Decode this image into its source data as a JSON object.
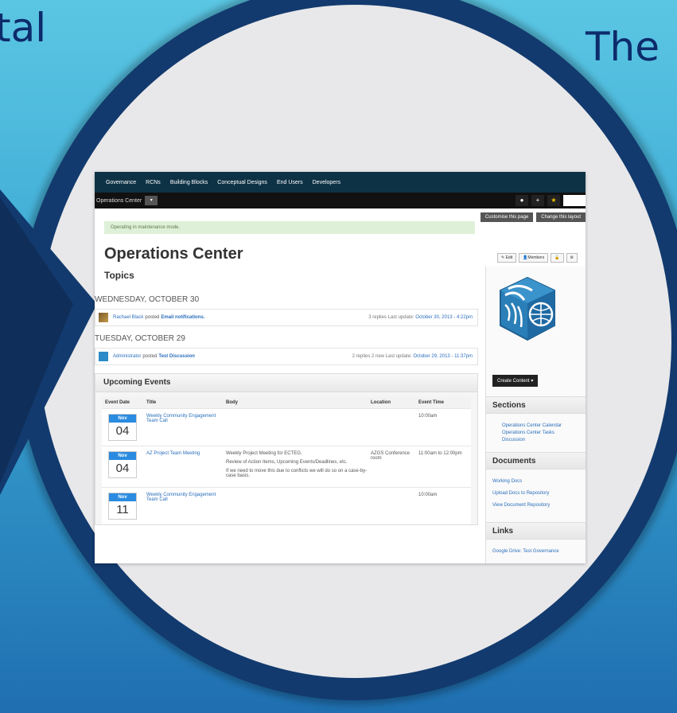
{
  "slide": {
    "word_left": "tal",
    "word_right": "The"
  },
  "nav": {
    "items": [
      "Governance",
      "RCNs",
      "Building Blocks",
      "Conceptual Designs",
      "End Users",
      "Developers"
    ]
  },
  "breadcrumb": {
    "label": "Operations Center",
    "toggle": "▾"
  },
  "toolbar": {
    "customise": "Customise this page",
    "change_layout": "Change this layout"
  },
  "alert": {
    "text": "Operating in maintenance mode."
  },
  "page": {
    "title": "Operations Center",
    "topics_heading": "Topics"
  },
  "topics": [
    {
      "day": "WEDNESDAY, OCTOBER 30",
      "author": "Rachael Black",
      "verb": "posted",
      "title": "Email notifications.",
      "meta": "3 replies Last update:",
      "date": "October 30, 2013 - 4:22pm"
    },
    {
      "day": "TUESDAY, OCTOBER 29",
      "author": "Administrator",
      "verb": "posted",
      "title": "Test Discussion",
      "meta": "2 replies 2 new Last update:",
      "date": "October 29, 2013 - 11:37pm"
    }
  ],
  "events": {
    "heading": "Upcoming Events",
    "columns": [
      "Event Date",
      "Title",
      "Body",
      "Location",
      "Event Time"
    ],
    "rows": [
      {
        "month": "Nov",
        "day": "04",
        "title": "Weekly Community Engagement Team Call",
        "body": [
          "",
          "",
          ""
        ],
        "location": "",
        "time": "10:00am"
      },
      {
        "month": "Nov",
        "day": "04",
        "title": "AZ Project Team Meeting",
        "body": [
          "Weekly Project Meeting for ECTEG.",
          "Review of Action Items, Upcoming Events/Deadlines, etc.",
          "If we need to move this due to conflicts we will do so on a case-by-case basis."
        ],
        "location": "AZGS Conference room",
        "time": "11:00am to 12:00pm"
      },
      {
        "month": "Nov",
        "day": "11",
        "title": "Weekly Community Engagement Team Call",
        "body": [
          "",
          "",
          ""
        ],
        "location": "",
        "time": "10:00am"
      }
    ]
  },
  "sidebar": {
    "buttons": [
      "✎ Edit",
      "👤Members",
      "🔓",
      "⚙"
    ],
    "create_label": "Create Content ▾",
    "sections_heading": "Sections",
    "sections": [
      "Operations Center Calendar",
      "Operations Center Tasks",
      "Discussion"
    ],
    "documents_heading": "Documents",
    "documents": [
      "Working Docs",
      "Upload Docs to Repository",
      "View Document Repository"
    ],
    "links_heading": "Links",
    "links": [
      "Google Drive: Test Governance"
    ]
  },
  "colors": {
    "ring": "#123a6e",
    "nav": "#0e3245",
    "link": "#2a6ebb",
    "calendar": "#2a8be0"
  }
}
